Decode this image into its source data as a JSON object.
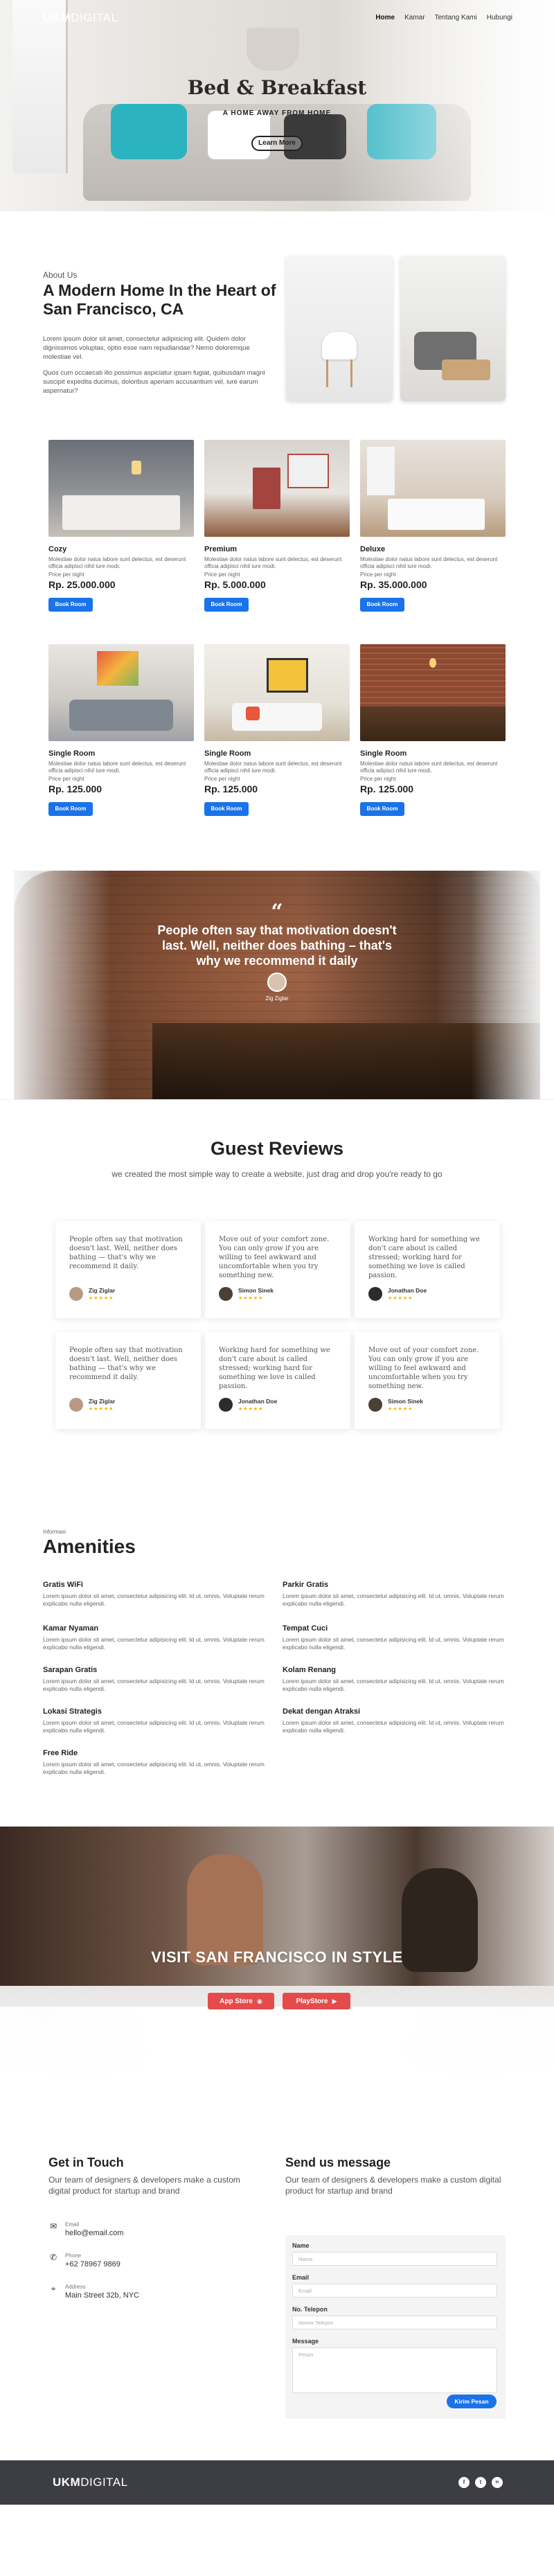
{
  "nav": {
    "logo_bold": "UKM",
    "logo_light": "DIGITAL",
    "items": [
      {
        "label": "Home",
        "active": true
      },
      {
        "label": "Kamar",
        "active": false
      },
      {
        "label": "Tentang Kami",
        "active": false
      },
      {
        "label": "Hubungi",
        "active": false
      }
    ]
  },
  "hero": {
    "title": "Bed & Breakfast",
    "subtitle": "A HOME AWAY FROM HOME",
    "button": "Learn More"
  },
  "about": {
    "kicker": "About Us",
    "title": "A Modern Home In the Heart of San Francisco, CA",
    "p1": "Lorem ipsum dolor sit amet, consectetur adipisicing elit. Quidem dolor dignissimos voluptas, optio esse nam repudiandae? Nemo doloremque molestiae vel.",
    "p2": "Quos cum occaecati illo possimus aspiciatur ipsam fugiat, quibusdam magni suscipit expedita ducimus, doloribus aperiam accusantium vel, iure earum aspernatur?"
  },
  "rooms": {
    "price_label": "Price per night",
    "button": "Book Room",
    "items": [
      {
        "name": "Cozy",
        "desc": "Molestiae dolor natus labore sunt delectus, est deserunt officia adipisci nihil iure modi.",
        "price": "Rp. 25.000.000"
      },
      {
        "name": "Premium",
        "desc": "Molestiae dolor natus labore sunt delectus, est deserunt officia adipisci nihil iure modi.",
        "price": "Rp. 5.000.000"
      },
      {
        "name": "Deluxe",
        "desc": "Molestiae dolor natus labore sunt delectus, est deserunt officia adipisci nihil iure modi.",
        "price": "Rp. 35.000.000"
      },
      {
        "name": "Single Room",
        "desc": "Molestiae dolor natus labore sunt delectus, est deserunt officia adipisci nihil iure modi.",
        "price": "Rp. 125.000"
      },
      {
        "name": "Single Room",
        "desc": "Molestiae dolor natus labore sunt delectus, est deserunt officia adipisci nihil iure modi.",
        "price": "Rp. 125.000"
      },
      {
        "name": "Single Room",
        "desc": "Molestiae dolor natus labore sunt delectus, est deserunt officia adipisci nihil iure modi.",
        "price": "Rp. 125.000"
      }
    ]
  },
  "quote": {
    "mark": "“",
    "text": "People often say that motivation doesn't last. Well, neither does bathing – that's why we recommend it daily",
    "author": "Zig Ziglar"
  },
  "reviews": {
    "title": "Guest Reviews",
    "subtitle": "we created the most simple way to create a website, just drag and drop you're ready to go",
    "stars": "★★★★★",
    "items": [
      {
        "text": "People often say that motivation doesn't last. Well, neither does bathing — that's why we recommend it daily.",
        "name": "Zig Ziglar"
      },
      {
        "text": "Move out of your comfort zone. You can only grow if you are willing to feel awkward and uncomfortable when you try something new.",
        "name": "Simon Sinek"
      },
      {
        "text": "Working hard for something we don't care about is called stressed; working hard for something we love is called passion.",
        "name": "Jonathan Doe"
      },
      {
        "text": "People often say that motivation doesn't last. Well, neither does bathing — that's why we recommend it daily.",
        "name": "Zig Ziglar"
      },
      {
        "text": "Working hard for something we don't care about is called stressed; working hard for something we love is called passion.",
        "name": "Jonathan Doe"
      },
      {
        "text": "Move out of your comfort zone. You can only grow if you are willing to feel awkward and uncomfortable when you try something new.",
        "name": "Simon Sinek"
      }
    ]
  },
  "amenities": {
    "kicker": "Informasi",
    "title": "Amenities",
    "desc": "Lorem ipsum dolor sit amet, consectetur adipisicing elit. Id ut, omnis. Voluptate rerum explicabo nulla eligendi.",
    "items": [
      "Gratis WiFi",
      "Parkir Gratis",
      "Kamar Nyaman",
      "Tempat Cuci",
      "Sarapan Gratis",
      "Kolam Renang",
      "Lokasi Strategis",
      "Dekat dengan Atraksi",
      "Free Ride"
    ]
  },
  "apps": {
    "title": "VISIT SAN FRANCISCO IN STYLE",
    "appstore": "App Store",
    "playstore": "PlayStore"
  },
  "contact": {
    "title": "Get in Touch",
    "subtitle": "Our team of designers & developers make a custom digital product for startup and brand",
    "email_label": "Email",
    "email": "hello@email.com",
    "phone_label": "Phone",
    "phone": "+62 78967 9869",
    "address_label": "Address",
    "address": "Main Street 32b, NYC"
  },
  "message": {
    "title": "Send us message",
    "subtitle": "Our team of designers & developers make a custom digital product for startup and brand",
    "name_label": "Name",
    "name_ph": "Nama",
    "email_label": "Email",
    "email_ph": "Email",
    "phone_label": "No. Telepon",
    "phone_ph": "Nomor Telepon",
    "message_label": "Message",
    "message_ph": "Pesan",
    "button": "Kirim Pesan"
  },
  "footer": {
    "logo_bold": "UKM",
    "logo_light": "DIGITAL",
    "social": [
      "f",
      "t",
      "in"
    ]
  },
  "colors": {
    "primary": "#1a73e8",
    "accent_red": "#e54b4b",
    "footer_bg": "#3d3d44",
    "stars": "#f5b301"
  }
}
